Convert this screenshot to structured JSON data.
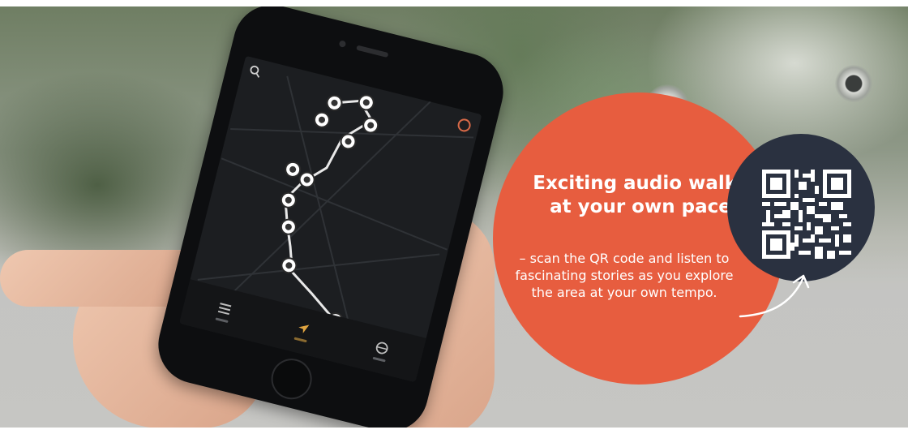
{
  "promo": {
    "headline": "Exciting audio walks at your own pace",
    "body": "– scan the QR code and listen to fascinating stories as you explore the area at your own tempo."
  },
  "colors": {
    "accent_orange": "#e75d3f",
    "qr_circle": "#2a3140",
    "text": "#ffffff"
  },
  "phone": {
    "tabs": [
      "list-icon",
      "navigate-arrow-icon",
      "globe-icon"
    ],
    "map_icons": [
      "search-icon",
      "compass-icon",
      "poi-marker-icon"
    ]
  },
  "qr_code_icon": "qr-code-icon",
  "arrow_icon": "curved-arrow-icon"
}
